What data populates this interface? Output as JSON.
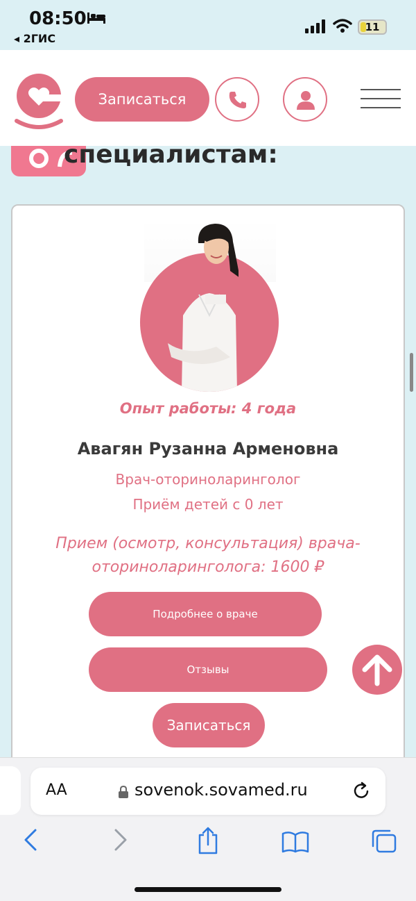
{
  "status_bar": {
    "time": "08:50",
    "back_app": "◂ 2ГИС",
    "battery": "11"
  },
  "header": {
    "book_label": "Записаться",
    "logo_icon": "heart-logo-icon",
    "phone_icon": "phone-icon",
    "user_icon": "user-icon",
    "menu_icon": "hamburger-menu-icon"
  },
  "section": {
    "heading": "специалистам:"
  },
  "doctor_card": {
    "experience": "Опыт работы: 4 года",
    "name": "Авагян Рузанна Арменовна",
    "specialty": "Врач-оториноларинголог",
    "age": "Приём детей с 0 лет",
    "price": "Прием (осмотр, консультация) врача-оториноларинголога: 1600 ₽",
    "details_label": "Подробнее о враче",
    "reviews_label": "Отзывы",
    "book_label": "Записаться"
  },
  "browser": {
    "text_size_label": "AA",
    "url": "sovenok.sovamed.ru"
  },
  "colors": {
    "accent": "#e07083",
    "background": "#dcf0f4"
  }
}
